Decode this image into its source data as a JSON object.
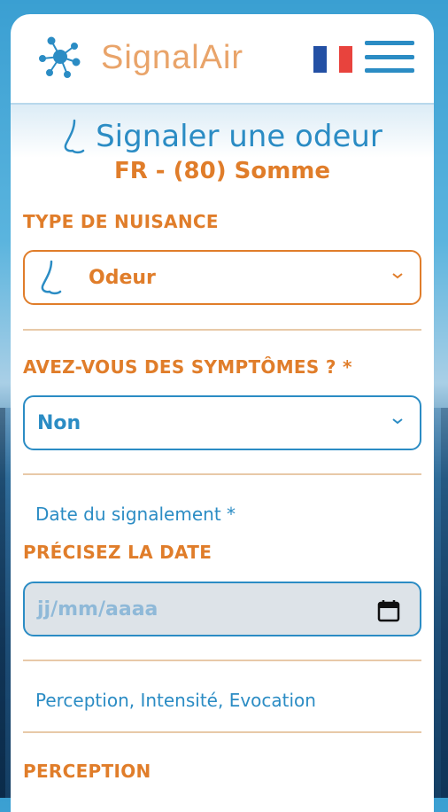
{
  "header": {
    "brand": "SignalAir",
    "logo_icon": "signalair-logo-icon",
    "flag_icon": "france-flag-icon",
    "menu_icon": "hamburger-menu-icon"
  },
  "page": {
    "title": "Signaler une odeur",
    "subtitle": "FR - (80) Somme",
    "title_icon": "nose-icon"
  },
  "nuisance": {
    "label": "TYPE DE NUISANCE",
    "value": "Odeur",
    "icon": "nose-icon"
  },
  "symptoms": {
    "label": "AVEZ-VOUS DES SYMPTÔMES ? *",
    "value": "Non"
  },
  "date": {
    "note": "Date du signalement *",
    "label": "PRÉCISEZ LA DATE",
    "placeholder": "jj/mm/aaaa",
    "icon": "calendar-icon"
  },
  "perception_note": "Perception, Intensité, Evocation",
  "perception_label": "PERCEPTION",
  "colors": {
    "primary": "#2b8cc4",
    "accent": "#e07d2a",
    "divider": "#e8c9a8"
  }
}
